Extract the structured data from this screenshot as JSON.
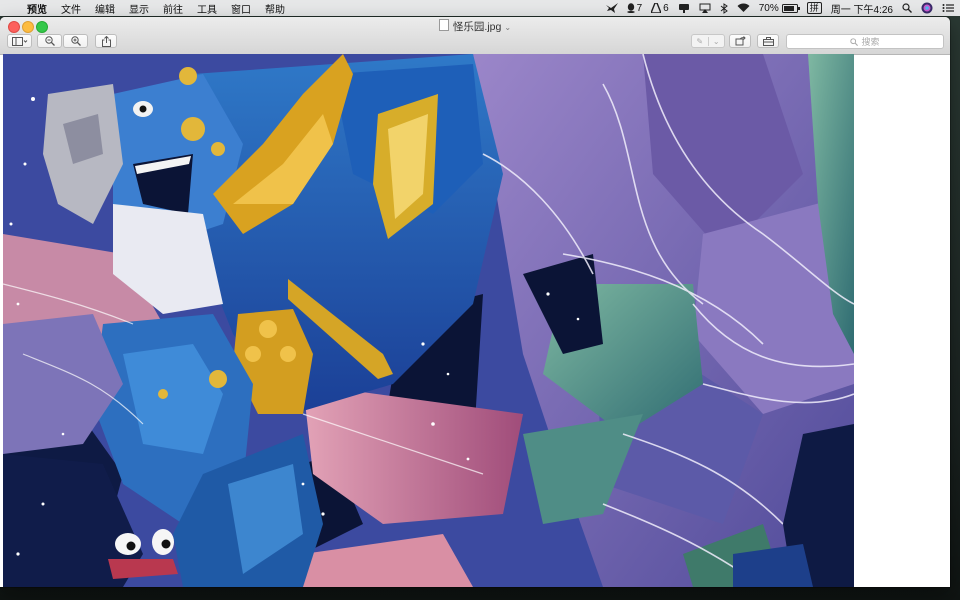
{
  "menubar": {
    "app_name": "预览",
    "menus": [
      "文件",
      "编辑",
      "显示",
      "前往",
      "工具",
      "窗口",
      "帮助"
    ],
    "status": {
      "qq_count": "7",
      "ai_count": "6",
      "battery": "70%",
      "input_method": "拼",
      "clock": "周一 下午4:26"
    }
  },
  "window": {
    "title": "怪乐园.jpg",
    "search_placeholder": "搜索"
  },
  "colors": {
    "deep_blue": "#1f4aa8",
    "navy": "#0b1436",
    "purple": "#7a6ab0",
    "lilac": "#b7a6d8",
    "mustard": "#d9a91e",
    "teal": "#3e8f8a",
    "rose": "#c76c8f"
  }
}
